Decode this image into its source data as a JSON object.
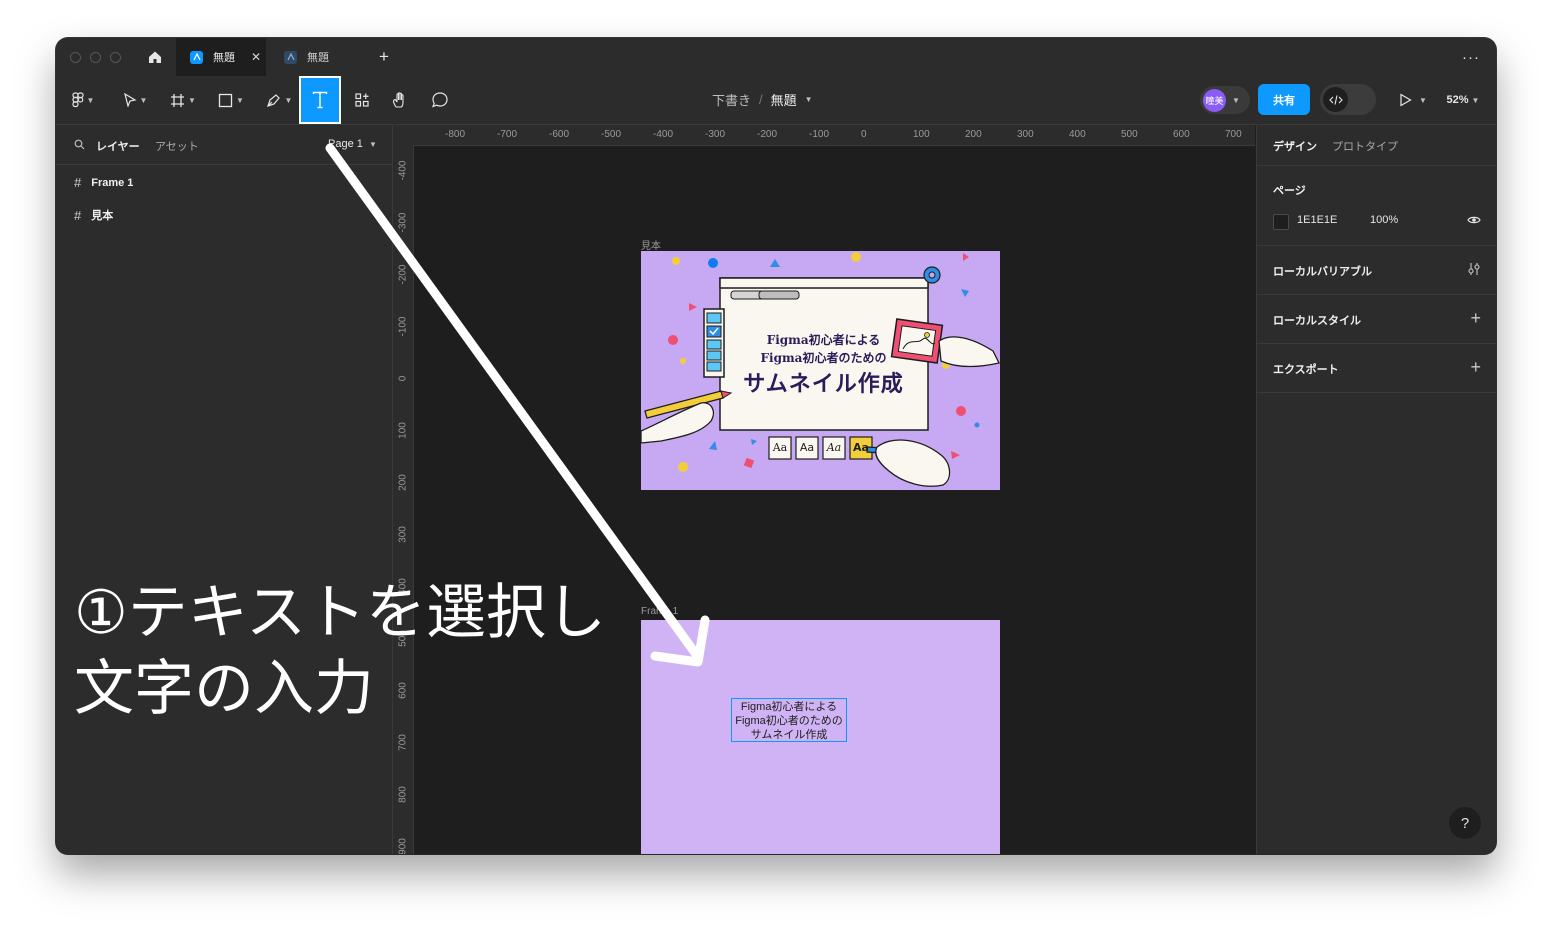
{
  "tabs": [
    {
      "title": "無題",
      "active": true
    },
    {
      "title": "無題",
      "active": false
    }
  ],
  "toolbar": {
    "breadcrumb_parent": "下書き",
    "breadcrumb_separator": "/",
    "file_title": "無題",
    "avatar_initials": "瞳美",
    "share_label": "共有",
    "zoom": "52%"
  },
  "left_panel": {
    "tab_layers": "レイヤー",
    "tab_assets": "アセット",
    "page_selector": "Page 1",
    "layers": [
      "Frame 1",
      "見本"
    ]
  },
  "right_panel": {
    "tab_design": "デザイン",
    "tab_prototype": "プロトタイプ",
    "page_section": "ページ",
    "page_color": "1E1E1E",
    "page_opacity": "100%",
    "local_variables": "ローカルバリアブル",
    "local_styles": "ローカルスタイル",
    "export": "エクスポート"
  },
  "rulers": {
    "horizontal": [
      "-800",
      "-700",
      "-600",
      "-500",
      "-400",
      "-300",
      "-200",
      "-100",
      "0",
      "100",
      "200",
      "300",
      "400",
      "500",
      "600",
      "700"
    ],
    "vertical": [
      "-400",
      "-300",
      "-200",
      "-100",
      "0",
      "100",
      "200",
      "300",
      "400",
      "500",
      "600",
      "700",
      "800",
      "900"
    ]
  },
  "canvas": {
    "frame_sample_label": "見本",
    "frame1_label": "Frame 1",
    "sample_line1": "Figma初心者による",
    "sample_line2": "Figma初心者のための",
    "sample_line3": "サムネイル作成",
    "font_samples": [
      "Aa",
      "Aa",
      "Aa",
      "Aa"
    ],
    "text_box_lines": [
      "Figma初心者による",
      "Figma初心者のための",
      "サムネイル作成"
    ]
  },
  "annotation": {
    "line1": "①テキストを選択し",
    "line2": "文字の入力"
  },
  "help_label": "?",
  "colors": {
    "accent": "#0d99ff",
    "frame_bg": "#d0b3f5",
    "sample_bg": "#c7a8f3"
  }
}
